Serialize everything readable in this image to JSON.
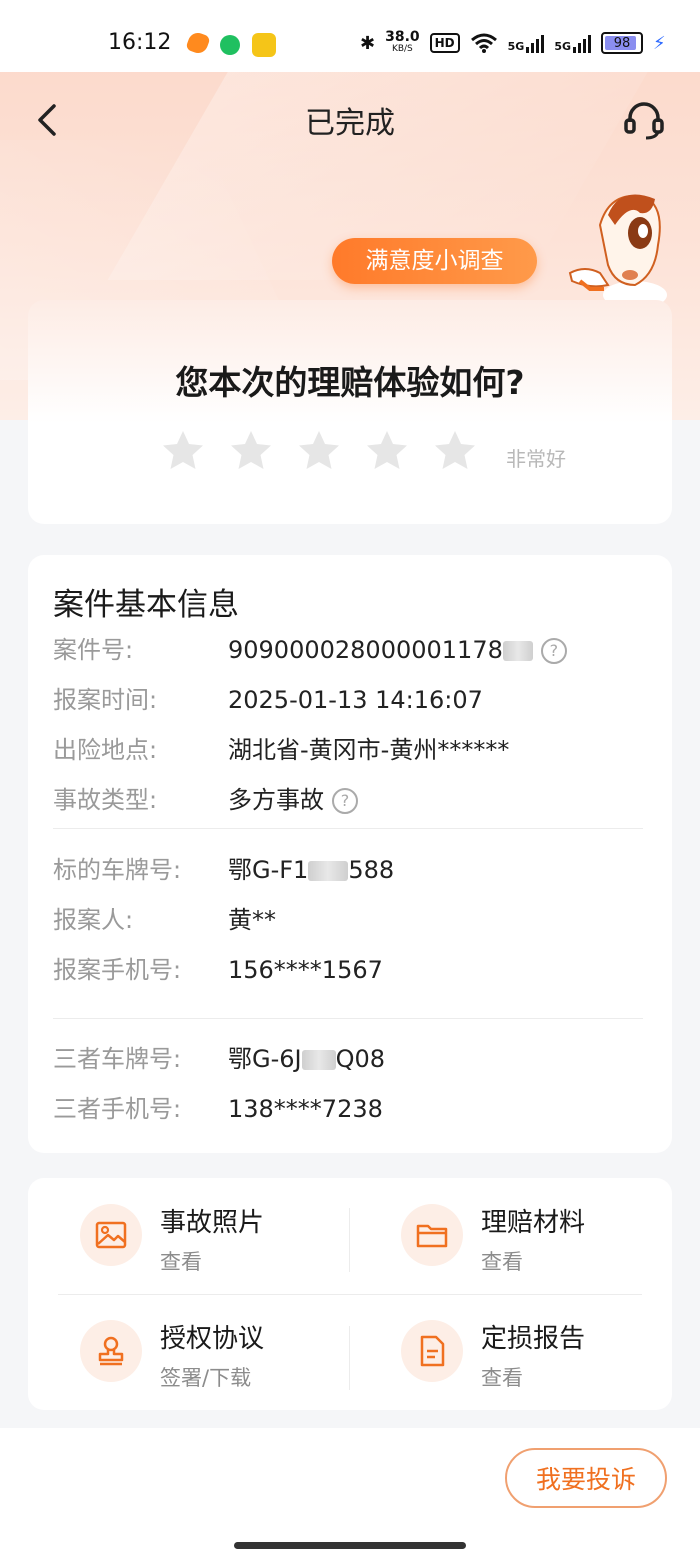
{
  "status_bar": {
    "time": "16:12",
    "network_speed_value": "38.0",
    "network_speed_unit": "KB/S",
    "hd_badge": "HD",
    "signal_1": "5G",
    "signal_2": "5G",
    "battery": "98"
  },
  "nav": {
    "title": "已完成",
    "back_icon": "chevron-left-icon",
    "service_icon": "headset-icon"
  },
  "survey": {
    "tag": "满意度小调查",
    "question": "您本次的理赔体验如何?",
    "rating_label": "非常好",
    "star_count": 5,
    "stars_filled": 0
  },
  "case_info": {
    "title": "案件基本信息",
    "rows": [
      {
        "label": "案件号:",
        "value": "909000028000001178"
      },
      {
        "label": "报案时间:",
        "value": "2025-01-13 14:16:07"
      },
      {
        "label": "出险地点:",
        "value": "湖北省-黄冈市-黄州******"
      },
      {
        "label": "事故类型:",
        "value": "多方事故"
      },
      {
        "label": "标的车牌号:",
        "value": "鄂G-F1",
        "value_tail": "588"
      },
      {
        "label": "报案人:",
        "value": "黄**"
      },
      {
        "label": "报案手机号:",
        "value": "156****1567"
      },
      {
        "label": "三者车牌号:",
        "value": "鄂G-6J",
        "value_tail": "Q08"
      },
      {
        "label": "三者手机号:",
        "value": "138****7238"
      }
    ]
  },
  "actions": [
    {
      "title": "事故照片",
      "subtitle": "查看",
      "icon": "image-icon"
    },
    {
      "title": "理赔材料",
      "subtitle": "查看",
      "icon": "folder-icon"
    },
    {
      "title": "授权协议",
      "subtitle": "签署/下载",
      "icon": "stamp-icon"
    },
    {
      "title": "定损报告",
      "subtitle": "查看",
      "icon": "document-icon"
    }
  ],
  "footer": {
    "complain_label": "我要投诉"
  },
  "colors": {
    "accent": "#f07020",
    "hero_bg": "#fbd7c8",
    "star_empty": "#e6e6e6"
  }
}
